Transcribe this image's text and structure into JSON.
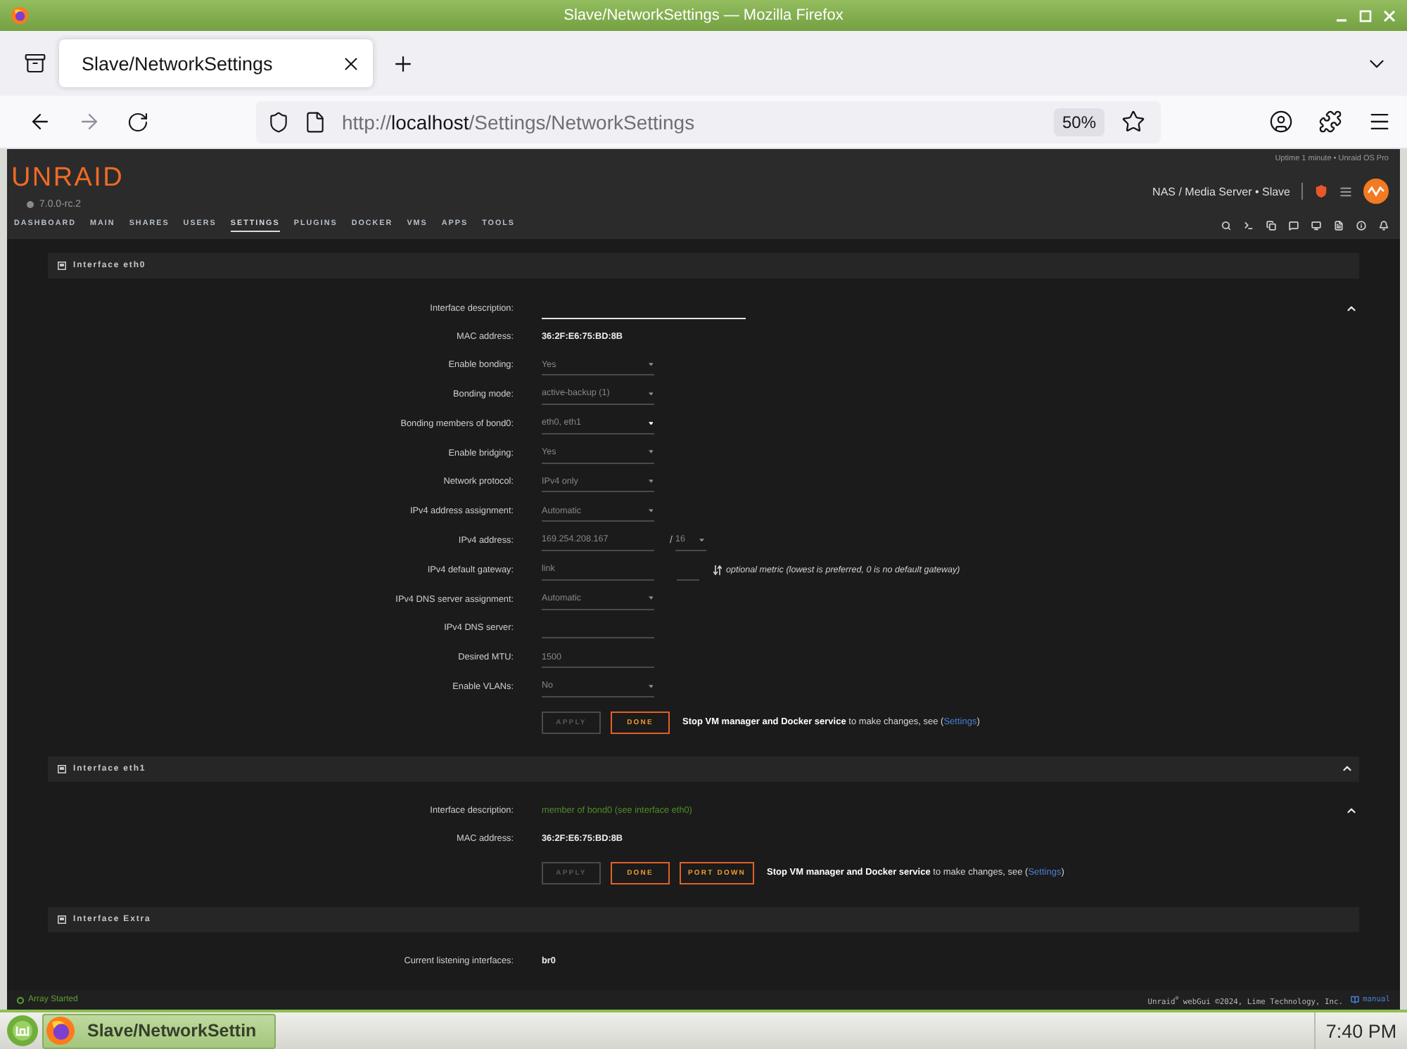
{
  "window": {
    "title": "Slave/NetworkSettings — Mozilla Firefox"
  },
  "browser": {
    "tabs": [
      {
        "label": "Slave/NetworkSettings",
        "selected": true
      }
    ],
    "address": {
      "scheme": "http://",
      "host": "localhost",
      "path": "/Settings/NetworkSettings"
    },
    "zoom": "50%"
  },
  "header": {
    "logo": "UNRAID",
    "version": "7.0.0-rc.2",
    "status": "Uptime 1 minute • Unraid OS Pro",
    "server": "NAS / Media Server • Slave",
    "nav": [
      {
        "label": "DASHBOARD",
        "selected": false
      },
      {
        "label": "MAIN",
        "selected": false
      },
      {
        "label": "SHARES",
        "selected": false
      },
      {
        "label": "USERS",
        "selected": false
      },
      {
        "label": "SETTINGS",
        "selected": true
      },
      {
        "label": "PLUGINS",
        "selected": false
      },
      {
        "label": "DOCKER",
        "selected": false
      },
      {
        "label": "VMS",
        "selected": false
      },
      {
        "label": "APPS",
        "selected": false
      },
      {
        "label": "TOOLS",
        "selected": false
      }
    ]
  },
  "sections": [
    {
      "title": "Interface eth0",
      "header_toggle": false,
      "body_toggle": true,
      "fields": [
        {
          "label": "Interface description:",
          "kind": "textfield",
          "disabled": false
        },
        {
          "label": "MAC address:",
          "kind": "text",
          "value": "36:2F:E6:75:BD:8B"
        },
        {
          "label": "Enable bonding:",
          "kind": "select",
          "value": "Yes",
          "disabled": true
        },
        {
          "label": "Bonding mode:",
          "kind": "select",
          "value": "active-backup (1)",
          "disabled": true
        },
        {
          "label": "Bonding members of bond0:",
          "kind": "multiselect",
          "value": "eth0, eth1",
          "disabled": true
        },
        {
          "label": "Enable bridging:",
          "kind": "select",
          "value": "Yes",
          "disabled": true
        },
        {
          "label": "Network protocol:",
          "kind": "select",
          "value": "IPv4 only",
          "disabled": true
        },
        {
          "label": "IPv4 address assignment:",
          "kind": "select",
          "value": "Automatic",
          "disabled": true
        },
        {
          "label": "IPv4 address:",
          "kind": "address",
          "value": "169.254.208.167",
          "separator": "/",
          "prefix": "16",
          "disabled": true
        },
        {
          "label": "IPv4 default gateway:",
          "kind": "gateway",
          "value": "link",
          "note": "optional metric (lowest is preferred, 0 is no default gateway)",
          "disabled": true
        },
        {
          "label": "IPv4 DNS server assignment:",
          "kind": "select",
          "value": "Automatic",
          "disabled": true
        },
        {
          "label": "IPv4 DNS server:",
          "kind": "input",
          "disabled": true
        },
        {
          "label": "Desired MTU:",
          "kind": "input",
          "value": "1500",
          "disabled": true
        },
        {
          "label": "Enable VLANs:",
          "kind": "select",
          "value": "No",
          "disabled": true
        }
      ],
      "buttons": [
        {
          "label": "APPLY",
          "disabled": true
        },
        {
          "label": "DONE",
          "disabled": false
        }
      ],
      "notice": {
        "text": "**Stop VM manager and Docker service** to make changes, see (",
        "link": "Settings",
        "end": ")"
      }
    },
    {
      "title": "Interface eth1",
      "header_toggle": true,
      "body_toggle": true,
      "fields": [
        {
          "label": "Interface description:",
          "kind": "note",
          "value": "member of bond0 (see interface eth0)"
        },
        {
          "label": "MAC address:",
          "kind": "text",
          "value": "36:2F:E6:75:BD:8B"
        }
      ],
      "buttons": [
        {
          "label": "APPLY",
          "disabled": true
        },
        {
          "label": "DONE",
          "disabled": false
        },
        {
          "label": "PORT DOWN",
          "disabled": false
        }
      ],
      "notice": {
        "text": "**Stop VM manager and Docker service** to make changes, see (",
        "link": "Settings",
        "end": ")"
      }
    },
    {
      "title": "Interface Extra",
      "header_toggle": false,
      "body_toggle": false,
      "fields": [
        {
          "label": "Current listening interfaces:",
          "kind": "text",
          "value": "br0"
        }
      ]
    }
  ],
  "footer": {
    "status": "Array Started",
    "copyright": "Unraid$^{®}$ webGui ©2024, Lime Technology, Inc.",
    "manual": "manual"
  },
  "taskbar": {
    "task": "Slave/NetworkSettin",
    "clock": "7:40 PM"
  }
}
